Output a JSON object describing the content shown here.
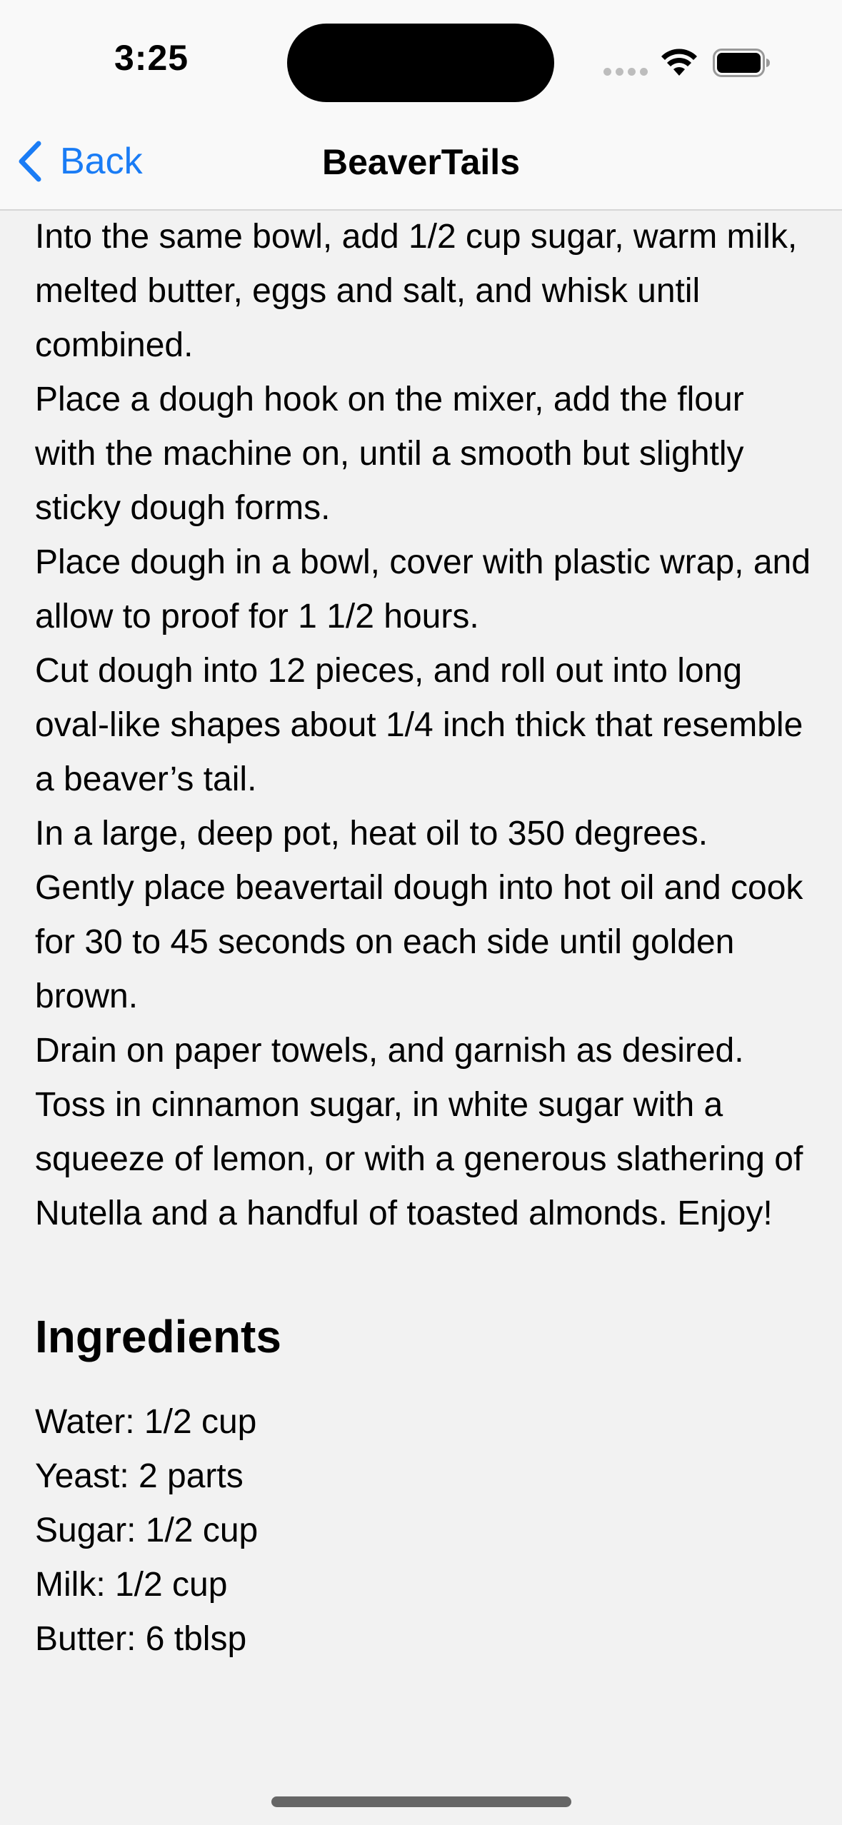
{
  "status_bar": {
    "time": "3:25",
    "icons": [
      "signal-dots-icon",
      "wifi-icon",
      "battery-icon"
    ]
  },
  "nav": {
    "back_label": "Back",
    "title": "BeaverTails",
    "accent_color": "#1a7cf5"
  },
  "steps": [
    "Into the same bowl, add 1/2 cup sugar, warm milk, melted butter, eggs and salt, and whisk until combined.",
    "Place a dough hook on the mixer, add the flour with the machine on, until a smooth but slightly sticky dough forms.",
    "Place dough in a bowl, cover with plastic wrap, and allow to proof for 1 1/2 hours.",
    "Cut dough into 12 pieces, and roll out into long oval-like shapes about 1/4 inch thick that resemble a beaver’s tail.",
    "In a large, deep pot, heat oil to 350 degrees.",
    "Gently place beavertail dough into hot oil and cook for 30 to 45 seconds on each side until golden brown.",
    "Drain on paper towels, and garnish as desired. Toss in cinnamon sugar, in white sugar with a squeeze of lemon, or with a generous slathering of Nutella and a handful of toasted almonds. Enjoy!"
  ],
  "ingredients_section": {
    "title": "Ingredients",
    "items": [
      "Water: 1/2 cup",
      "Yeast: 2 parts",
      "Sugar: 1/2 cup",
      "Milk: 1/2 cup",
      "Butter: 6 tblsp"
    ]
  }
}
